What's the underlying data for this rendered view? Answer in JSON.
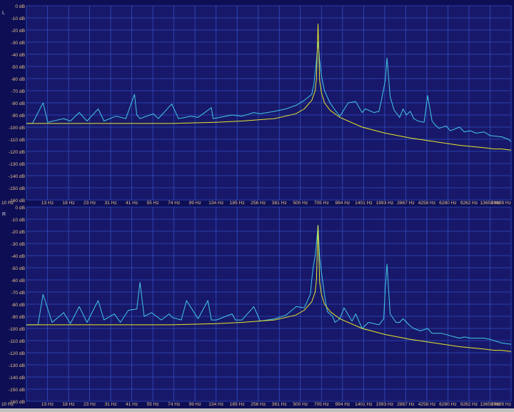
{
  "colors": {
    "plot_bg": "#18186a",
    "frame_bg": "#0e0e55",
    "grid": "#2f4fc0",
    "tick_label": "#e4c08a",
    "channel_label": "#d8d8d8",
    "series_primary": "#42c8e4",
    "series_secondary": "#e6e62a"
  },
  "chart_data": [
    {
      "type": "line",
      "title": "L",
      "xscale": "log",
      "xlim": [
        10,
        20899
      ],
      "ylim": [
        -160,
        0
      ],
      "grid": true,
      "x_tick_labels": [
        "10 Hz",
        "13 Hz",
        "18 Hz",
        "23 Hz",
        "31 Hz",
        "41 Hz",
        "55 Hz",
        "74 Hz",
        "99 Hz",
        "134 Hz",
        "185 Hz",
        "256 Hz",
        "361 Hz",
        "500 Hz",
        "705 Hz",
        "994 Hz",
        "1401 Hz",
        "1993 Hz",
        "2867 Hz",
        "4258 Hz",
        "6280 Hz",
        "9262 Hz",
        "13659 Hz",
        "20899 Hz"
      ],
      "y_tick_labels": [
        "0 dB",
        "-10 dB",
        "-20 dB",
        "-30 dB",
        "-40 dB",
        "-50 dB",
        "-60 dB",
        "-70 dB",
        "-80 dB",
        "-90 dB",
        "-100 dB",
        "-110 dB",
        "-120 dB",
        "-130 dB",
        "-140 dB",
        "-150 dB",
        "-160 dB"
      ],
      "series": [
        {
          "color": "#42c8e4",
          "x": [
            10,
            11,
            13,
            14,
            18,
            20,
            23,
            26,
            31,
            34,
            41,
            48,
            55,
            57,
            60,
            74,
            80,
            99,
            110,
            134,
            150,
            185,
            190,
            256,
            300,
            361,
            400,
            500,
            600,
            705,
            800,
            900,
            930,
            950,
            970,
            994,
            1020,
            1050,
            1100,
            1200,
            1300,
            1401,
            1600,
            1800,
            1993,
            2100,
            2400,
            2600,
            2700,
            2867,
            2950,
            3100,
            3300,
            3600,
            3800,
            4000,
            4258,
            4500,
            4800,
            5300,
            5600,
            6000,
            6280,
            6700,
            7500,
            8000,
            9262,
            10000,
            11000,
            12000,
            13659,
            15000,
            18000,
            20000,
            20899
          ],
          "y": [
            -97,
            -97,
            -80,
            -96,
            -93,
            -95,
            -88,
            -95,
            -85,
            -95,
            -91,
            -93,
            -73,
            -90,
            -93,
            -89,
            -93,
            -81,
            -93,
            -91,
            -92,
            -84,
            -93,
            -90,
            -91,
            -88,
            -89,
            -87,
            -85,
            -82,
            -78,
            -73,
            -65,
            -55,
            -45,
            -30,
            -45,
            -58,
            -70,
            -80,
            -86,
            -91,
            -80,
            -79,
            -88,
            -85,
            -88,
            -87,
            -78,
            -62,
            -43,
            -75,
            -86,
            -92,
            -85,
            -90,
            -87,
            -93,
            -95,
            -96,
            -74,
            -95,
            -98,
            -101,
            -99,
            -103,
            -100,
            -104,
            -103,
            -105,
            -104,
            -107,
            -108,
            -110,
            -112
          ]
        },
        {
          "color": "#e6e62a",
          "x": [
            10,
            100,
            200,
            300,
            500,
            700,
            800,
            900,
            950,
            970,
            994,
            1020,
            1050,
            1100,
            1200,
            1401,
            1993,
            2867,
            4258,
            6280,
            9262,
            13659,
            16000,
            18000,
            20899
          ],
          "y": [
            -97,
            -97,
            -96,
            -95,
            -93,
            -89,
            -85,
            -78,
            -70,
            -60,
            -15,
            -62,
            -72,
            -80,
            -86,
            -92,
            -100,
            -105,
            -109,
            -112,
            -115,
            -117,
            -118,
            -118,
            -119
          ]
        }
      ]
    },
    {
      "type": "line",
      "title": "R",
      "xscale": "log",
      "xlim": [
        10,
        20899
      ],
      "ylim": [
        -160,
        0
      ],
      "grid": true,
      "x_tick_labels": [
        "10 Hz",
        "13 Hz",
        "18 Hz",
        "23 Hz",
        "31 Hz",
        "41 Hz",
        "55 Hz",
        "74 Hz",
        "99 Hz",
        "134 Hz",
        "185 Hz",
        "256 Hz",
        "361 Hz",
        "500 Hz",
        "705 Hz",
        "994 Hz",
        "1401 Hz",
        "1993 Hz",
        "2867 Hz",
        "4258 Hz",
        "6280 Hz",
        "9262 Hz",
        "13659 Hz",
        "20899 Hz"
      ],
      "y_tick_labels": [
        "0 dB",
        "-10 dB",
        "-20 dB",
        "-30 dB",
        "-40 dB",
        "-50 dB",
        "-60 dB",
        "-70 dB",
        "-80 dB",
        "-90 dB",
        "-100 dB",
        "-110 dB",
        "-120 dB",
        "-130 dB",
        "-140 dB",
        "-150 dB",
        "-160 dB"
      ],
      "series": [
        {
          "color": "#42c8e4",
          "x": [
            10,
            12,
            13,
            15,
            18,
            20,
            23,
            26,
            31,
            34,
            40,
            44,
            50,
            57,
            60,
            64,
            72,
            84,
            95,
            100,
            115,
            125,
            150,
            175,
            185,
            200,
            256,
            270,
            300,
            361,
            400,
            500,
            600,
            705,
            800,
            880,
            900,
            920,
            950,
            970,
            994,
            1020,
            1050,
            1100,
            1150,
            1250,
            1300,
            1401,
            1500,
            1700,
            1800,
            1993,
            2200,
            2600,
            2800,
            2867,
            2950,
            3100,
            3400,
            3600,
            3800,
            4258,
            4500,
            5000,
            5600,
            6000,
            6280,
            7000,
            8000,
            9262,
            10000,
            11000,
            13659,
            15000,
            18000,
            20899
          ],
          "y": [
            -97,
            -97,
            -72,
            -95,
            -87,
            -96,
            -82,
            -95,
            -77,
            -93,
            -88,
            -95,
            -85,
            -84,
            -62,
            -90,
            -87,
            -93,
            -88,
            -91,
            -93,
            -77,
            -92,
            -77,
            -93,
            -93,
            -88,
            -93,
            -93,
            -82,
            -94,
            -92,
            -89,
            -82,
            -83,
            -72,
            -60,
            -50,
            -40,
            -30,
            -15,
            -42,
            -54,
            -72,
            -86,
            -90,
            -95,
            -92,
            -83,
            -94,
            -88,
            -100,
            -95,
            -97,
            -92,
            -68,
            -47,
            -88,
            -95,
            -95,
            -92,
            -98,
            -100,
            -102,
            -100,
            -104,
            -104,
            -104,
            -106,
            -108,
            -107,
            -108,
            -108,
            -109,
            -112,
            -113
          ]
        },
        {
          "color": "#e6e62a",
          "x": [
            10,
            100,
            200,
            300,
            500,
            700,
            800,
            900,
            950,
            970,
            994,
            1020,
            1050,
            1100,
            1200,
            1401,
            1993,
            2867,
            4258,
            6280,
            9262,
            13659,
            16000,
            18000,
            20899
          ],
          "y": [
            -97,
            -97,
            -96,
            -95,
            -93,
            -89,
            -85,
            -78,
            -70,
            -60,
            -15,
            -62,
            -72,
            -80,
            -86,
            -92,
            -100,
            -105,
            -109,
            -112,
            -115,
            -117,
            -118,
            -118,
            -119
          ]
        }
      ]
    }
  ]
}
